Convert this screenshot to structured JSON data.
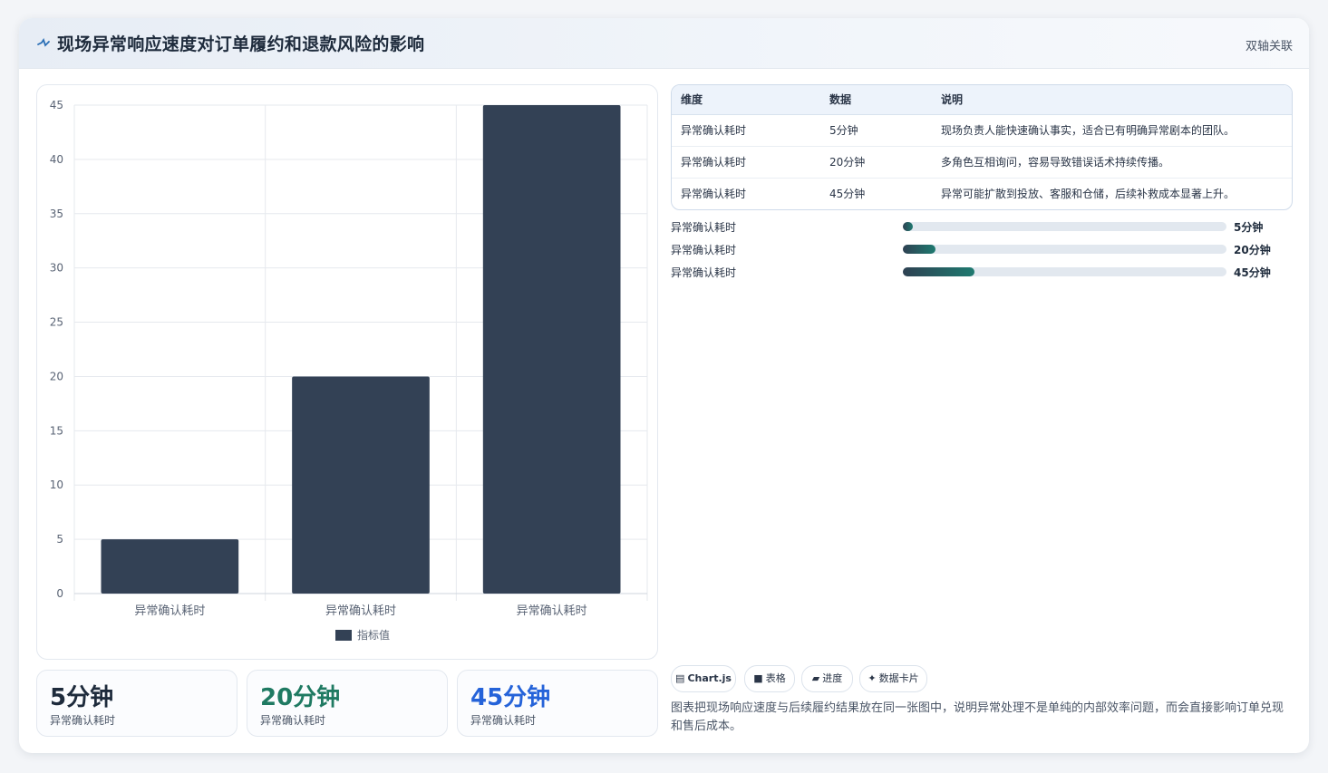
{
  "header": {
    "title": "现场异常响应速度对订单履约和退款风险的影响",
    "tag": "双轴关联"
  },
  "chart_data": {
    "type": "bar",
    "categories": [
      "异常确认耗时",
      "异常确认耗时",
      "异常确认耗时"
    ],
    "series": [
      {
        "name": "指标值",
        "values": [
          5,
          20,
          45
        ]
      }
    ],
    "ylim": [
      0,
      45
    ],
    "yticks": [
      0,
      5,
      10,
      15,
      20,
      25,
      30,
      35,
      40,
      45
    ],
    "grid": true,
    "legend": "bottom",
    "colors": {
      "bar": "#334155",
      "grid": "#e6e9ee",
      "tick": "#5a6475"
    }
  },
  "table": {
    "headers": [
      "维度",
      "数据",
      "说明"
    ],
    "rows": [
      [
        "异常确认耗时",
        "5分钟",
        "现场负责人能快速确认事实，适合已有明确异常剧本的团队。"
      ],
      [
        "异常确认耗时",
        "20分钟",
        "多角色互相询问，容易导致错误话术持续传播。"
      ],
      [
        "异常确认耗时",
        "45分钟",
        "异常可能扩散到投放、客服和仓储，后续补救成本显著上升。"
      ]
    ]
  },
  "progress": [
    {
      "label": "异常确认耗时",
      "value": "5分钟",
      "fraction": 0.03
    },
    {
      "label": "异常确认耗时",
      "value": "20分钟",
      "fraction": 0.1
    },
    {
      "label": "异常确认耗时",
      "value": "45分钟",
      "fraction": 0.22
    }
  ],
  "stats": [
    {
      "value": "5分钟",
      "label": "异常确认耗时",
      "color": "#1e2b3c"
    },
    {
      "value": "20分钟",
      "label": "异常确认耗时",
      "color": "#1f7a62"
    },
    {
      "value": "45分钟",
      "label": "异常确认耗时",
      "color": "#2563d9"
    }
  ],
  "chips": [
    {
      "icon": "chart-icon",
      "glyph": "▤",
      "label": "Chart.js"
    },
    {
      "icon": "table-icon",
      "glyph": "■",
      "label": "表格"
    },
    {
      "icon": "progress-icon",
      "glyph": "▰",
      "label": "进度"
    },
    {
      "icon": "card-icon",
      "glyph": "✦",
      "label": "数据卡片"
    }
  ],
  "description": "图表把现场响应速度与后续履约结果放在同一张图中，说明异常处理不是单纯的内部效率问题，而会直接影响订单兑现和售后成本。"
}
